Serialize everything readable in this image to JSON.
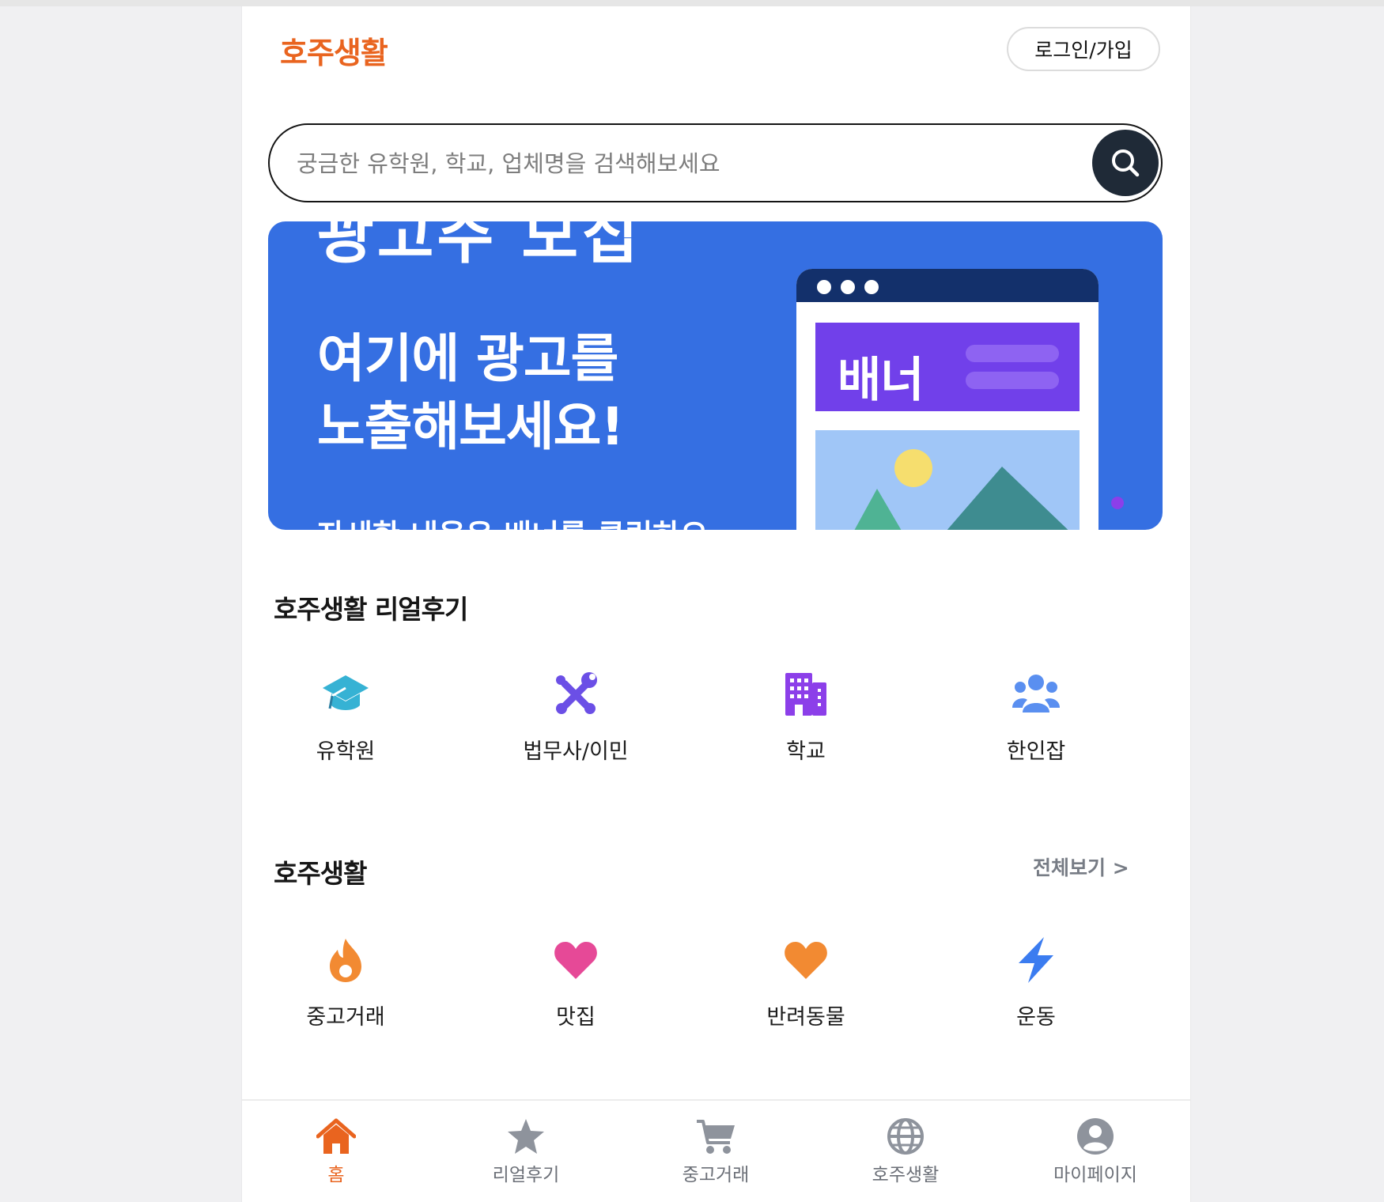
{
  "header": {
    "logo": "호주생활",
    "login_label": "로그인/가입"
  },
  "search": {
    "placeholder": "궁금한 유학원, 학교, 업체명을 검색해보세요",
    "icon": "search-icon"
  },
  "ad_banner": {
    "top_text": "광고주 모집",
    "line1": "여기에 광고를",
    "line2": "노출해보세요!",
    "bottom_text": "자세한 내용은 배너를 클릭하요",
    "mock_label": "배너",
    "colors": {
      "background": "#356fe2",
      "mock_banner": "#7140ea",
      "mock_bar": "#13306b"
    }
  },
  "reviews": {
    "title": "호주생활 리얼후기",
    "categories": [
      {
        "label": "유학원",
        "icon": "graduation-cap-icon",
        "color": "#36b2d4"
      },
      {
        "label": "법무사/이민",
        "icon": "tools-icon",
        "color": "#6b4fe6"
      },
      {
        "label": "학교",
        "icon": "building-icon",
        "color": "#8c3fe9"
      },
      {
        "label": "한인잡",
        "icon": "users-icon",
        "color": "#5a8ff0"
      }
    ]
  },
  "life": {
    "title": "호주생활",
    "see_all": "전체보기 >",
    "categories": [
      {
        "label": "중고거래",
        "icon": "fire-icon",
        "color": "#f28a32"
      },
      {
        "label": "맛집",
        "icon": "heart-icon",
        "color": "#e64997"
      },
      {
        "label": "반려동물",
        "icon": "heart-icon",
        "color": "#f28a32"
      },
      {
        "label": "운동",
        "icon": "bolt-icon",
        "color": "#3b7cf0"
      }
    ]
  },
  "nav": {
    "items": [
      {
        "label": "홈",
        "icon": "home-icon",
        "active": true
      },
      {
        "label": "리얼후기",
        "icon": "star-icon",
        "active": false
      },
      {
        "label": "중고거래",
        "icon": "cart-icon",
        "active": false
      },
      {
        "label": "호주생활",
        "icon": "globe-icon",
        "active": false
      },
      {
        "label": "마이페이지",
        "icon": "user-circle-icon",
        "active": false
      }
    ],
    "colors": {
      "active": "#e9641f",
      "inactive": "#8e939c"
    }
  }
}
